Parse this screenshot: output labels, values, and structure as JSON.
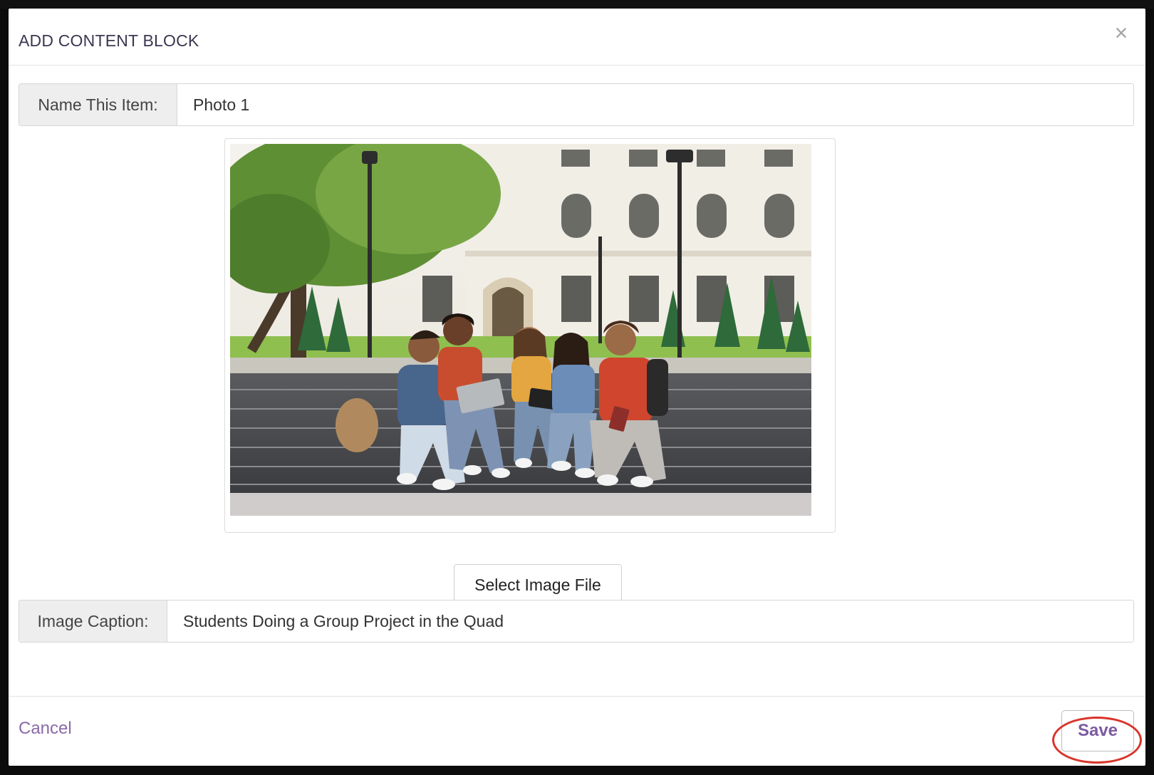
{
  "modal": {
    "title": "ADD CONTENT BLOCK",
    "close_symbol": "×"
  },
  "name_field": {
    "label": "Name This Item:",
    "value": "Photo 1"
  },
  "preview_image": {
    "icon": "photo-preview"
  },
  "select_image_button": {
    "label": "Select Image File"
  },
  "caption_field": {
    "label": "Image Caption:",
    "value": "Students Doing a Group Project in the Quad"
  },
  "footer": {
    "cancel_label": "Cancel",
    "save_label": "Save"
  },
  "colors": {
    "title": "#3d3651",
    "link": "#8a6aa8",
    "save_text": "#7c5aa0",
    "highlight": "#d9352b",
    "addon_bg": "#eeeeee"
  }
}
